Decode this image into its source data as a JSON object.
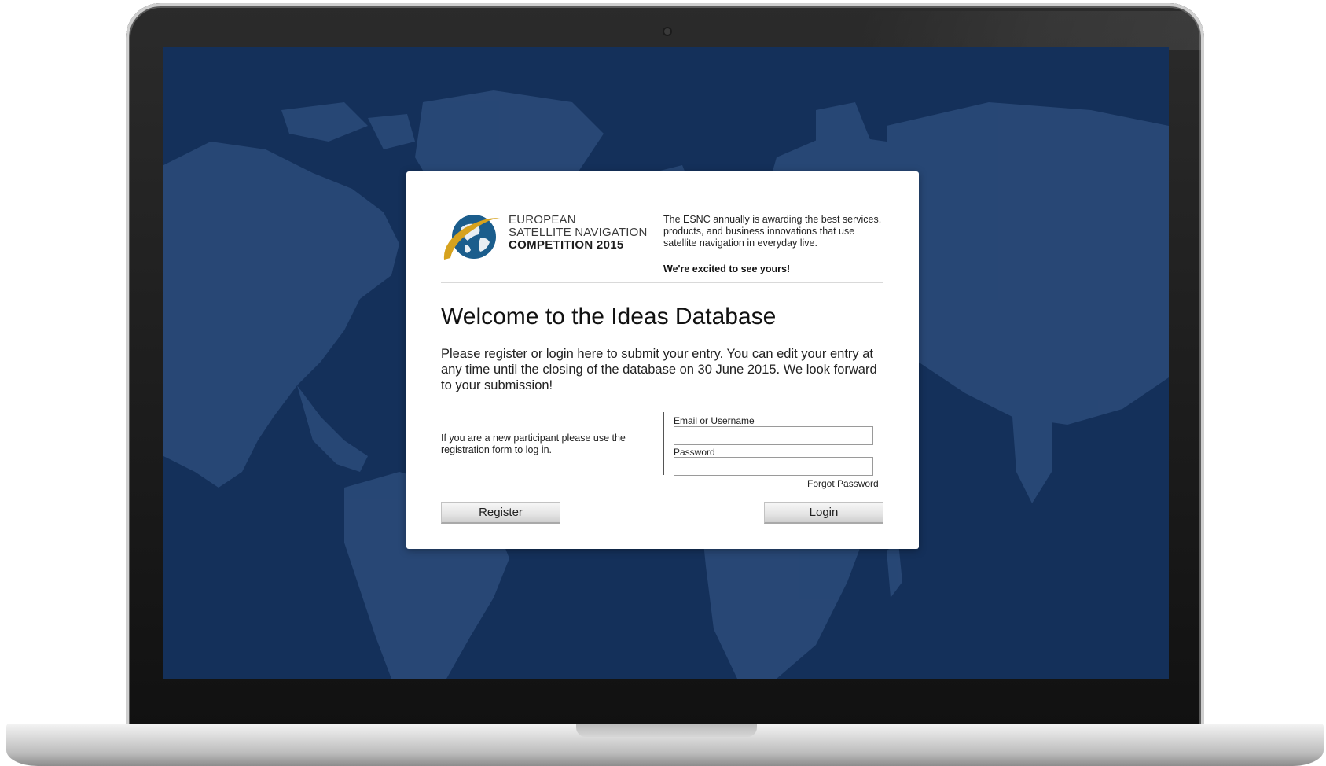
{
  "logo": {
    "line1": "EUROPEAN",
    "line2": "SATELLITE NAVIGATION",
    "line3": "COMPETITION 2015"
  },
  "header": {
    "description": "The ESNC annually is awarding the best services, products, and business innovations that use satellite navigation in everyday live.",
    "cta": "We're excited to see yours!"
  },
  "main": {
    "title": "Welcome to the Ideas Database",
    "intro": "Please register or login here to submit your entry. You can edit your entry at any time until the closing of the database on 30 June 2015. We look forward to your submission!",
    "new_participant_text": "If you are a new participant please use the registration form to log in."
  },
  "login_form": {
    "email_label": "Email or Username",
    "email_value": "",
    "password_label": "Password",
    "password_value": "",
    "forgot_password": "Forgot Password"
  },
  "buttons": {
    "register": "Register",
    "login": "Login"
  },
  "colors": {
    "screen_background": "#14305a",
    "map_land": "#2a4a78",
    "logo_gold": "#d6a21e",
    "logo_globe": "#1b5d8c"
  },
  "icons": {
    "logo": "globe-with-orbit-icon",
    "camera": "camera-icon"
  }
}
